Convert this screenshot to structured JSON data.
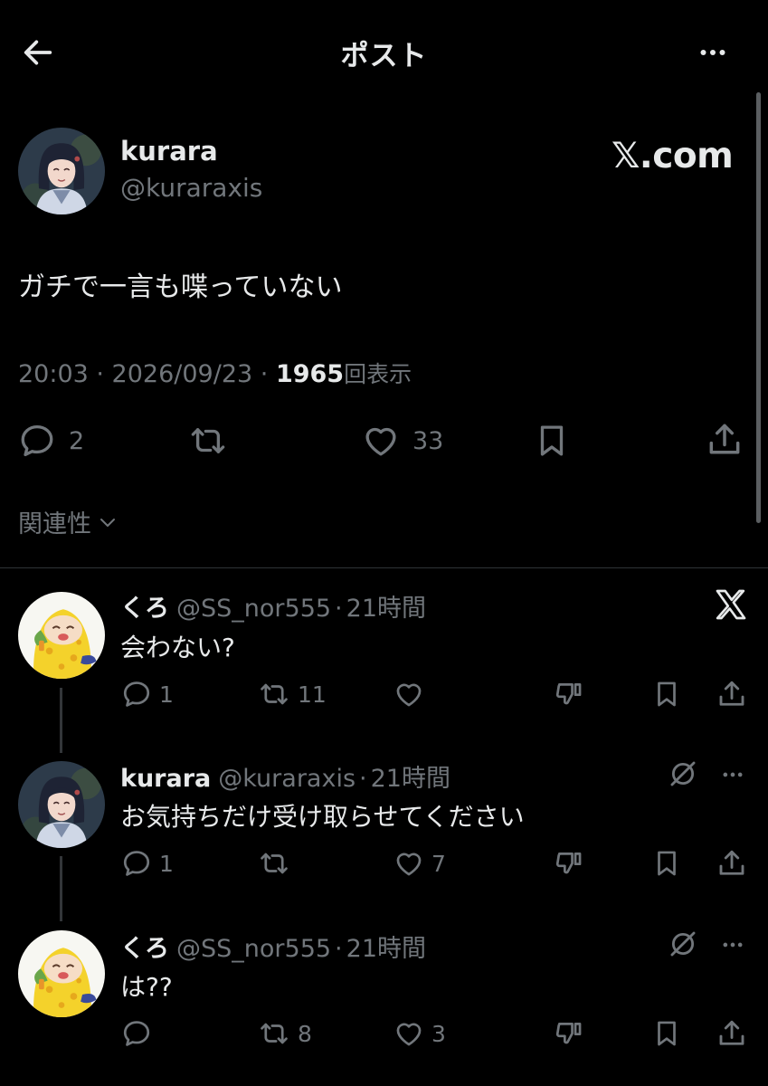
{
  "header": {
    "title": "ポスト"
  },
  "post": {
    "author_name": "kurara",
    "author_handle": "@kuraraxis",
    "watermark": "𝕏.com",
    "text": "ガチで一言も喋っていない",
    "timestamp": "20:03 · 2026/09/23 · ",
    "views_count": "1965",
    "views_label": "回表示",
    "replies": "2",
    "reposts": "",
    "likes": "33"
  },
  "sort": {
    "label": "関連性"
  },
  "replies": [
    {
      "name": "くろ",
      "handle": "@SS_nor555",
      "sep": "·",
      "time": "21時間",
      "text": "会わない?",
      "replies": "1",
      "reposts": "11",
      "likes": "",
      "corner_icon": "x-logo-icon"
    },
    {
      "name": "kurara",
      "handle": "@kuraraxis",
      "sep": "·",
      "time": "21時間",
      "text": "お気持ちだけ受け取らせてください",
      "replies": "1",
      "reposts": "",
      "likes": "7",
      "corner_icon": "grok-icon"
    },
    {
      "name": "くろ",
      "handle": "@SS_nor555",
      "sep": "·",
      "time": "21時間",
      "text": "は??",
      "replies": "",
      "reposts": "8",
      "likes": "3",
      "corner_icon": "grok-icon"
    }
  ],
  "colors": {
    "background": "#000000",
    "text": "#e7e9ea",
    "muted": "#71767b",
    "divider": "#2f3336"
  }
}
